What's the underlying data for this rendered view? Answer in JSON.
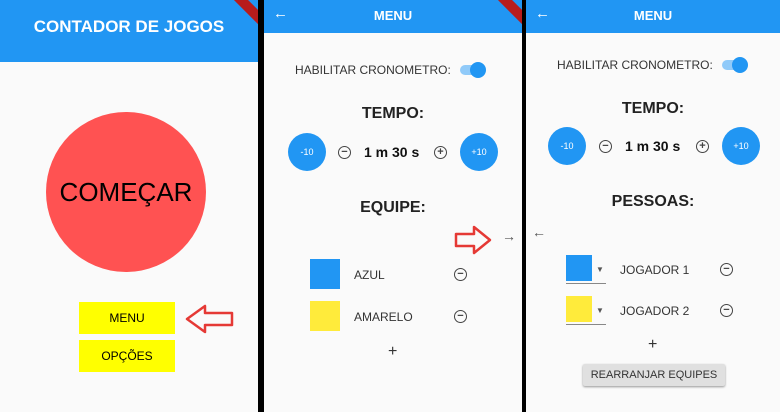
{
  "colors": {
    "appbar": "#2196f3",
    "start_circle": "#ff5252",
    "yellow_button": "#ffff00",
    "team_blue": "#2196f3",
    "team_yellow": "#ffeb3b",
    "annotation_arrow": "#e53935"
  },
  "screen1": {
    "title": "CONTADOR DE JOGOS",
    "start_label": "COMEÇAR",
    "menu_label": "MENU",
    "options_label": "OPÇÕES"
  },
  "screen2": {
    "title": "MENU",
    "timer_toggle_label": "HABILITAR CRONOMETRO:",
    "time_heading": "TEMPO:",
    "minus10": "-10",
    "plus10": "+10",
    "time_value": "1 m 30 s",
    "teams_heading": "EQUIPE:",
    "teams": [
      {
        "name": "AZUL"
      },
      {
        "name": "AMARELO"
      }
    ],
    "add_label": "+"
  },
  "screen3": {
    "title": "MENU",
    "timer_toggle_label": "HABILITAR CRONOMETRO:",
    "time_heading": "TEMPO:",
    "minus10": "-10",
    "plus10": "+10",
    "time_value": "1 m 30 s",
    "people_heading": "PESSOAS:",
    "players": [
      {
        "name": "JOGADOR 1"
      },
      {
        "name": "JOGADOR 2"
      }
    ],
    "add_label": "+",
    "rearrange_label": "REARRANJAR EQUIPES"
  }
}
